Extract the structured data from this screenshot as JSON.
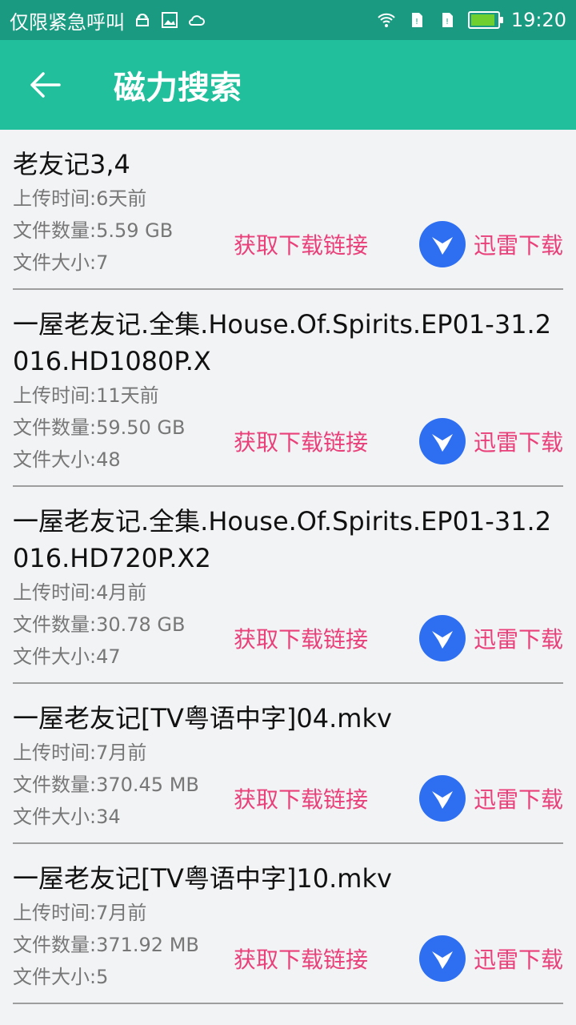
{
  "status_bar": {
    "carrier_text": "仅限紧急呼叫",
    "time": "19:20",
    "battery_color": "#6fcf2f"
  },
  "app_bar": {
    "title": "磁力搜索",
    "back_icon": "arrow-left-icon"
  },
  "results": [
    {
      "title": "老友记3,4",
      "upload": "上传时间:6天前",
      "count": "文件数量:5.59 GB",
      "size": "文件大小:7",
      "get_link": "获取下载链接",
      "thunder": "迅雷下载"
    },
    {
      "title": "一屋老友记.全集.House.Of.Spirits.EP01-31.2016.HD1080P.X",
      "upload": "上传时间:11天前",
      "count": "文件数量:59.50 GB",
      "size": "文件大小:48",
      "get_link": "获取下载链接",
      "thunder": "迅雷下载"
    },
    {
      "title": "一屋老友记.全集.House.Of.Spirits.EP01-31.2016.HD720P.X2",
      "upload": "上传时间:4月前",
      "count": "文件数量:30.78 GB",
      "size": "文件大小:47",
      "get_link": "获取下载链接",
      "thunder": "迅雷下载"
    },
    {
      "title": "一屋老友记[TV粤语中字]04.mkv",
      "upload": "上传时间:7月前",
      "count": "文件数量:370.45 MB",
      "size": "文件大小:34",
      "get_link": "获取下载链接",
      "thunder": "迅雷下载"
    },
    {
      "title": "一屋老友记[TV粤语中字]10.mkv",
      "upload": "上传时间:7月前",
      "count": "文件数量:371.92 MB",
      "size": "文件大小:5",
      "get_link": "获取下载链接",
      "thunder": "迅雷下载"
    }
  ]
}
